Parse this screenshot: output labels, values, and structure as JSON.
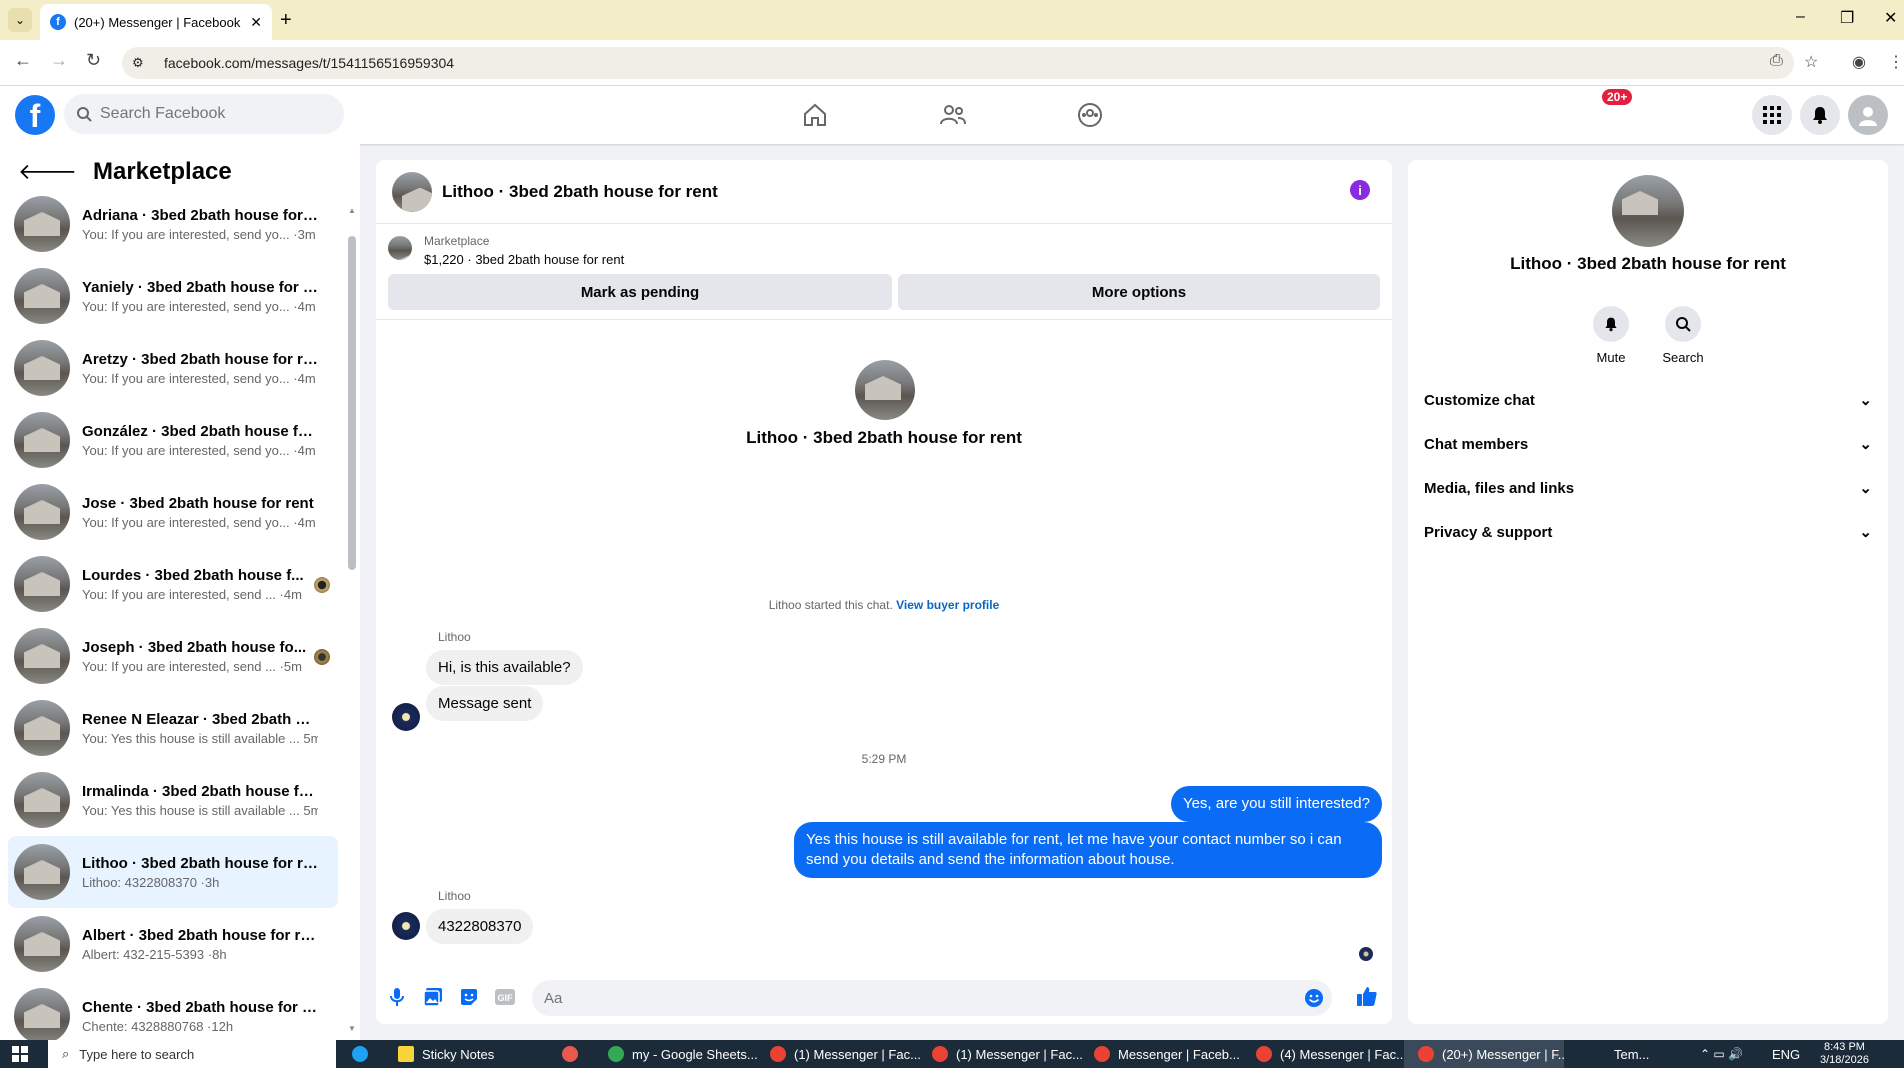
{
  "browser": {
    "tab_title": "(20+) Messenger | Facebook",
    "url": "facebook.com/messages/t/1541156516959304"
  },
  "fb": {
    "search_placeholder": "Search Facebook",
    "notif_badge": "20+"
  },
  "sidebar": {
    "title": "Marketplace",
    "conversations": [
      {
        "name": "Adriana · 3bed 2bath house for ...",
        "sub": "You: If you are interested, send yo... ·3m"
      },
      {
        "name": "Yaniely · 3bed 2bath house for r...",
        "sub": "You: If you are interested, send yo... ·4m"
      },
      {
        "name": "Aretzy · 3bed 2bath house for re...",
        "sub": "You: If you are interested, send yo... ·4m"
      },
      {
        "name": "González · 3bed 2bath house for...",
        "sub": "You: If you are interested, send yo... ·4m"
      },
      {
        "name": "Jose · 3bed 2bath house for rent",
        "sub": "You: If you are interested, send yo... ·4m"
      },
      {
        "name": "Lourdes · 3bed 2bath house f...",
        "sub": "You: If you are interested, send ... ·4m"
      },
      {
        "name": "Joseph · 3bed 2bath house fo...",
        "sub": "You: If you are interested, send ... ·5m"
      },
      {
        "name": "Renee N Eleazar · 3bed 2bath ho...",
        "sub": "You: Yes this house is still available ... 5m"
      },
      {
        "name": "Irmalinda · 3bed 2bath house fo...",
        "sub": "You: Yes this house is still available ... 5m"
      },
      {
        "name": "Lithoo · 3bed 2bath house for re...",
        "sub": "Lithoo: 4322808370 ·3h"
      },
      {
        "name": "Albert · 3bed 2bath house for rent",
        "sub": "Albert: 432-215-5393 ·8h"
      },
      {
        "name": "Chente · 3bed 2bath house for r...",
        "sub": "Chente: 4328880768 ·12h"
      }
    ]
  },
  "chat": {
    "title": "Lithoo · 3bed 2bath house for rent",
    "marketplace_label": "Marketplace",
    "listing": "$1,220 · 3bed 2bath house for rent",
    "mark_pending": "Mark as pending",
    "more_options": "More options",
    "center_name": "Lithoo · 3bed 2bath house for rent",
    "started_text": "Lithoo started this chat.",
    "view_profile": "View buyer profile",
    "sender1": "Lithoo",
    "msg1": "Hi, is this available?",
    "msg2": "Message sent",
    "timestamp": "5:29 PM",
    "out1": "Yes, are you still interested?",
    "out2": "Yes this house is still available for rent, let me have your contact number so i can send you details and send the information about house.",
    "sender2": "Lithoo",
    "msg3": "4322808370",
    "input_placeholder": "Aa"
  },
  "rpanel": {
    "name": "Lithoo · 3bed 2bath house for rent",
    "mute": "Mute",
    "search": "Search",
    "rows": [
      "Customize chat",
      "Chat members",
      "Media, files and links",
      "Privacy & support"
    ]
  },
  "taskbar": {
    "search": "Type here to search",
    "items": [
      "Sticky Notes",
      "my - Google Sheets...",
      "(1) Messenger | Fac...",
      "(1) Messenger | Fac...",
      "Messenger | Faceb...",
      "(4) Messenger | Fac...",
      "(20+) Messenger | F..."
    ],
    "weather": "Tem...",
    "lang": "ENG",
    "time": "8:43 PM",
    "date": "3/18/2026"
  }
}
